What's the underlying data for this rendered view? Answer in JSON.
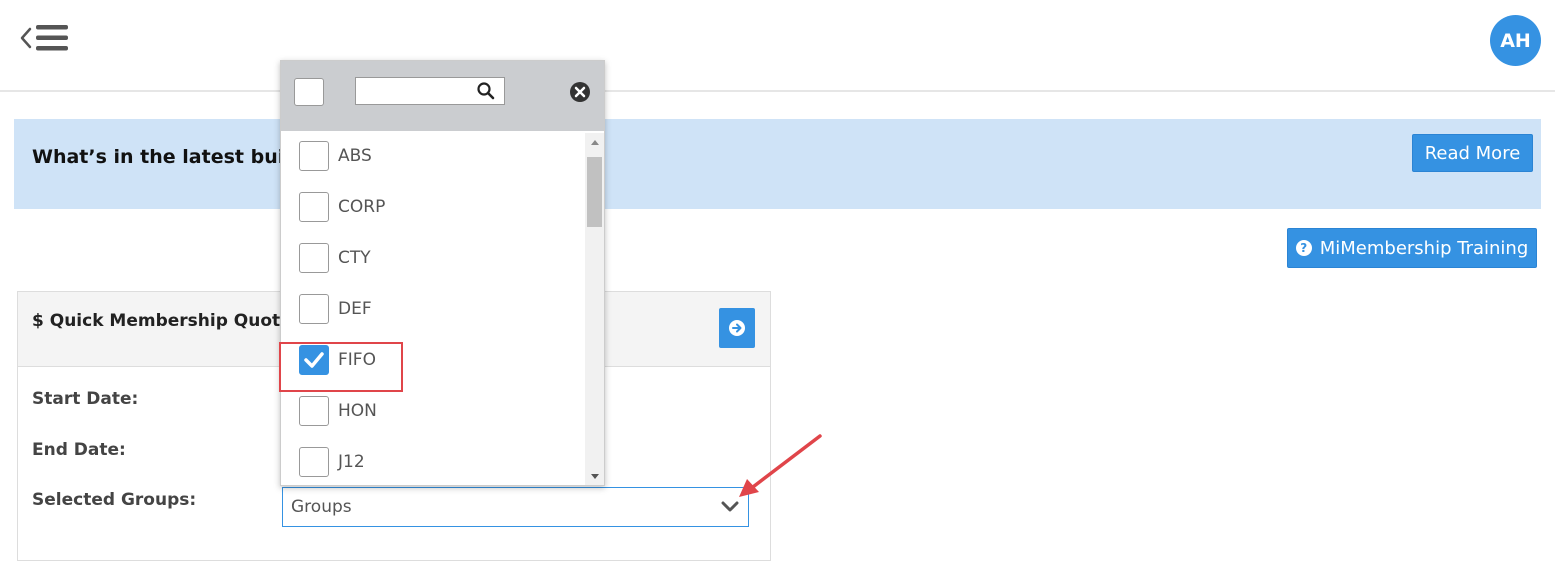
{
  "header": {
    "menu_icon": "menu-back-icon",
    "avatar_initials": "AH"
  },
  "banner": {
    "text": "What’s in the latest build",
    "read_more_label": "Read More"
  },
  "training_button": {
    "label": "MiMembership Training",
    "icon": "question-circle-icon"
  },
  "quote_panel": {
    "title": "$ Quick Membership Quote",
    "start_date_label": "Start Date:",
    "end_date_label": "End Date:",
    "selected_groups_label": "Selected Groups:",
    "groups_value": "Groups"
  },
  "groups_dropdown": {
    "search_value": "",
    "items": [
      {
        "label": "ABS",
        "checked": false
      },
      {
        "label": "CORP",
        "checked": false
      },
      {
        "label": "CTY",
        "checked": false
      },
      {
        "label": "DEF",
        "checked": false
      },
      {
        "label": "FIFO",
        "checked": true
      },
      {
        "label": "HON",
        "checked": false
      },
      {
        "label": "J12",
        "checked": false
      }
    ]
  },
  "colors": {
    "accent": "#3592e2",
    "banner_bg": "#cfe3f7",
    "annotation": "#e0454a"
  }
}
